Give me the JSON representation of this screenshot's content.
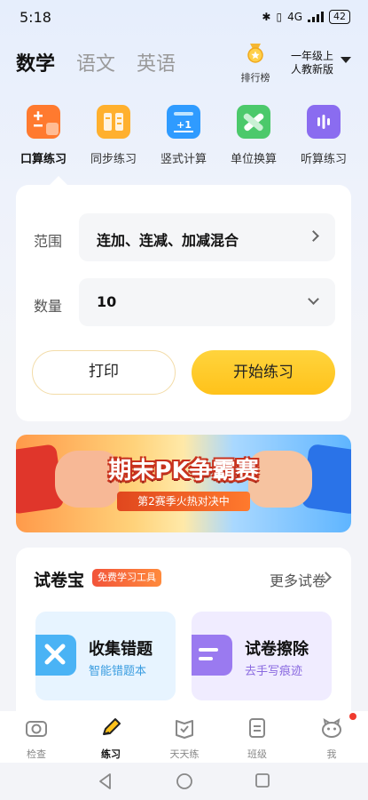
{
  "status_bar": {
    "time": "5:18",
    "signal": "4G",
    "battery": "42"
  },
  "subjects": [
    {
      "label": "数学",
      "active": true
    },
    {
      "label": "语文",
      "active": false
    },
    {
      "label": "英语",
      "active": false
    }
  ],
  "rank": {
    "label": "排行榜",
    "icon": "medal-icon"
  },
  "grade": {
    "line1": "一年级上",
    "line2": "人教新版"
  },
  "practice_tabs": [
    {
      "label": "口算练习",
      "icon": "oral-calc-icon",
      "color": "#ff7a2f",
      "active": true
    },
    {
      "label": "同步练习",
      "icon": "sync-practice-icon",
      "color": "#ffb02e",
      "active": false
    },
    {
      "label": "竖式计算",
      "icon": "vertical-calc-icon",
      "color": "#2f9bff",
      "active": false
    },
    {
      "label": "单位换算",
      "icon": "unit-convert-icon",
      "color": "#4cc96b",
      "active": false
    },
    {
      "label": "听算练习",
      "icon": "listen-calc-icon",
      "color": "#8a6cf0",
      "active": false
    }
  ],
  "settings": {
    "range_label": "范围",
    "range_value": "连加、连减、加减混合",
    "count_label": "数量",
    "count_value": "10",
    "print_button": "打印",
    "start_button": "开始练习"
  },
  "banner": {
    "title": "期末PK争霸赛",
    "subtitle": "第2赛季火热对决中"
  },
  "exam_tools": {
    "title": "试卷宝",
    "badge": "免费学习工具",
    "more": "更多试卷",
    "tools": [
      {
        "title": "收集错题",
        "subtitle": "智能错题本",
        "icon": "collect-mistakes-icon",
        "bg": "#e7f4ff",
        "accent": "#4ab3f5"
      },
      {
        "title": "试卷擦除",
        "subtitle": "去手写痕迹",
        "icon": "erase-paper-icon",
        "bg": "#f0ecff",
        "accent": "#9a7af0"
      }
    ]
  },
  "bottom_nav": [
    {
      "label": "检查",
      "icon": "camera-icon",
      "active": false
    },
    {
      "label": "练习",
      "icon": "pencil-icon",
      "active": true
    },
    {
      "label": "天天练",
      "icon": "daily-check-icon",
      "active": false
    },
    {
      "label": "班级",
      "icon": "class-icon",
      "active": false
    },
    {
      "label": "我",
      "icon": "profile-icon",
      "active": false
    }
  ]
}
